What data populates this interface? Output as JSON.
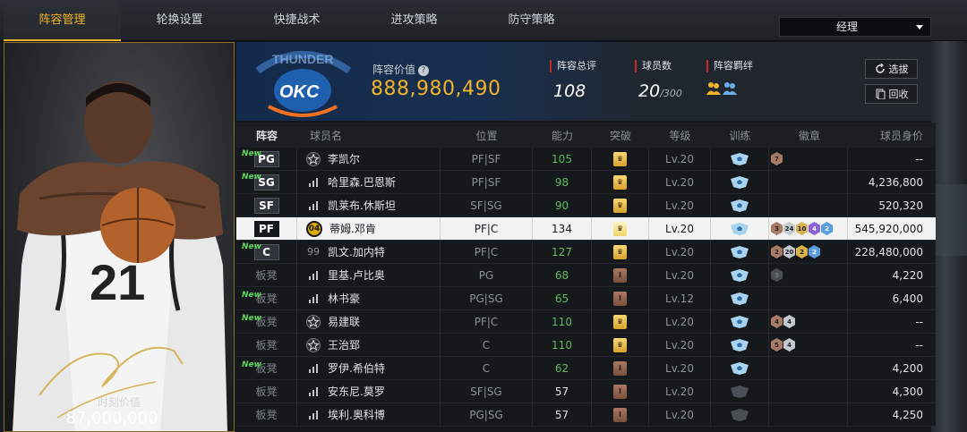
{
  "tabs": [
    {
      "label": "阵容管理",
      "active": true
    },
    {
      "label": "轮换设置",
      "active": false
    },
    {
      "label": "快捷战术",
      "active": false
    },
    {
      "label": "进攻策略",
      "active": false
    },
    {
      "label": "防守策略",
      "active": false
    }
  ],
  "manager_select": {
    "value": "经理"
  },
  "card": {
    "jersey_number": "21",
    "value_label": "时刻价值",
    "value": "87,000,000"
  },
  "team": {
    "logo_text": "OKC",
    "logo_arc_text": "THUNDER",
    "lineup_value_label": "阵容价值",
    "lineup_value": "888,980,490",
    "rating_label": "阵容总评",
    "rating": "108",
    "roster_label": "球员数",
    "roster_count": "20",
    "roster_max": "/300",
    "bond_label": "阵容羁绊",
    "select_label": "选拔",
    "recycle_label": "回收"
  },
  "table": {
    "headers": [
      "阵容",
      "球员名",
      "位置",
      "能力",
      "突破",
      "等级",
      "训练",
      "徽章",
      "球员身价"
    ],
    "rows": [
      {
        "pos": "PG",
        "new": "New",
        "icon": "star",
        "name": "李凯尔",
        "position": "PF|SF",
        "ability": "105",
        "ability_color": "green",
        "break": "gold",
        "level": "Lv.20",
        "train": "light",
        "badges": [
          {
            "t": "bronze",
            "v": "7"
          }
        ],
        "price": "--"
      },
      {
        "pos": "SG",
        "new": "New",
        "icon": "bars",
        "name": "哈里森.巴恩斯",
        "position": "PF|SF",
        "ability": "98",
        "ability_color": "green",
        "break": "gold",
        "level": "Lv.20",
        "train": "light",
        "badges": [],
        "price": "4,236,800"
      },
      {
        "pos": "SF",
        "new": "",
        "icon": "bars",
        "name": "凯莱布.休斯坦",
        "position": "SF|SG",
        "ability": "90",
        "ability_color": "green",
        "break": "gold",
        "level": "Lv.20",
        "train": "light",
        "badges": [],
        "price": "520,320"
      },
      {
        "pos": "PF",
        "new": "",
        "icon": "num",
        "icon_text": "04",
        "name": "蒂姆.邓肯",
        "position": "PF|C",
        "ability": "134",
        "ability_color": "plain",
        "break": "pale",
        "level": "Lv.20",
        "train": "light",
        "badges": [
          {
            "t": "bronze",
            "v": "3"
          },
          {
            "t": "silver",
            "v": "24"
          },
          {
            "t": "gold",
            "v": "10"
          },
          {
            "t": "purple",
            "v": "4"
          },
          {
            "t": "blue",
            "v": "2"
          }
        ],
        "price": "545,920,000",
        "selected": true
      },
      {
        "pos": "C",
        "new": "New",
        "icon": "text",
        "icon_text": "99",
        "name": "凯文.加内特",
        "position": "PF|C",
        "ability": "127",
        "ability_color": "green",
        "break": "gold",
        "level": "Lv.20",
        "train": "light",
        "badges": [
          {
            "t": "bronze",
            "v": "2"
          },
          {
            "t": "silver",
            "v": "20"
          },
          {
            "t": "gold",
            "v": "2"
          },
          {
            "t": "blue",
            "v": "2"
          }
        ],
        "price": "228,480,000"
      },
      {
        "pos": "板凳",
        "new": "",
        "icon": "bars",
        "name": "里基.卢比奥",
        "position": "PG",
        "ability": "68",
        "ability_color": "green",
        "break": "brown",
        "level": "Lv.20",
        "train": "light",
        "badges": [
          {
            "t": "dark",
            "v": "3"
          }
        ],
        "price": "4,220"
      },
      {
        "pos": "板凳",
        "new": "New",
        "icon": "bars",
        "name": "林书豪",
        "position": "PG|SG",
        "ability": "65",
        "ability_color": "green",
        "break": "brown",
        "level": "Lv.12",
        "train": "light",
        "badges": [],
        "price": "6,400"
      },
      {
        "pos": "板凳",
        "new": "New",
        "icon": "star",
        "name": "易建联",
        "position": "PF|C",
        "ability": "110",
        "ability_color": "green",
        "break": "gold",
        "level": "Lv.20",
        "train": "light",
        "badges": [
          {
            "t": "bronze",
            "v": "4"
          },
          {
            "t": "silver",
            "v": "4"
          }
        ],
        "price": "--"
      },
      {
        "pos": "板凳",
        "new": "",
        "icon": "star",
        "name": "王治郅",
        "position": "C",
        "ability": "110",
        "ability_color": "green",
        "break": "gold",
        "level": "Lv.20",
        "train": "light",
        "badges": [
          {
            "t": "bronze",
            "v": "5"
          },
          {
            "t": "silver",
            "v": "4"
          }
        ],
        "price": "--"
      },
      {
        "pos": "板凳",
        "new": "New",
        "icon": "bars",
        "name": "罗伊.希伯特",
        "position": "C",
        "ability": "62",
        "ability_color": "green",
        "break": "brown",
        "level": "Lv.20",
        "train": "light",
        "badges": [],
        "price": "4,200"
      },
      {
        "pos": "板凳",
        "new": "",
        "icon": "bars",
        "name": "安东尼.莫罗",
        "position": "SF|SG",
        "ability": "57",
        "ability_color": "plain",
        "break": "brown",
        "level": "Lv.20",
        "train": "dark",
        "badges": [],
        "price": "4,300"
      },
      {
        "pos": "板凳",
        "new": "",
        "icon": "bars",
        "name": "埃利.奥科博",
        "position": "PG|SG",
        "ability": "57",
        "ability_color": "plain",
        "break": "brown",
        "level": "Lv.20",
        "train": "dark",
        "badges": [],
        "price": "4,250"
      }
    ]
  },
  "colors": {
    "accent": "#f0b429",
    "green": "#5cb85c",
    "red_marker": "#c62828",
    "team_blue": "#1a2f4f"
  }
}
